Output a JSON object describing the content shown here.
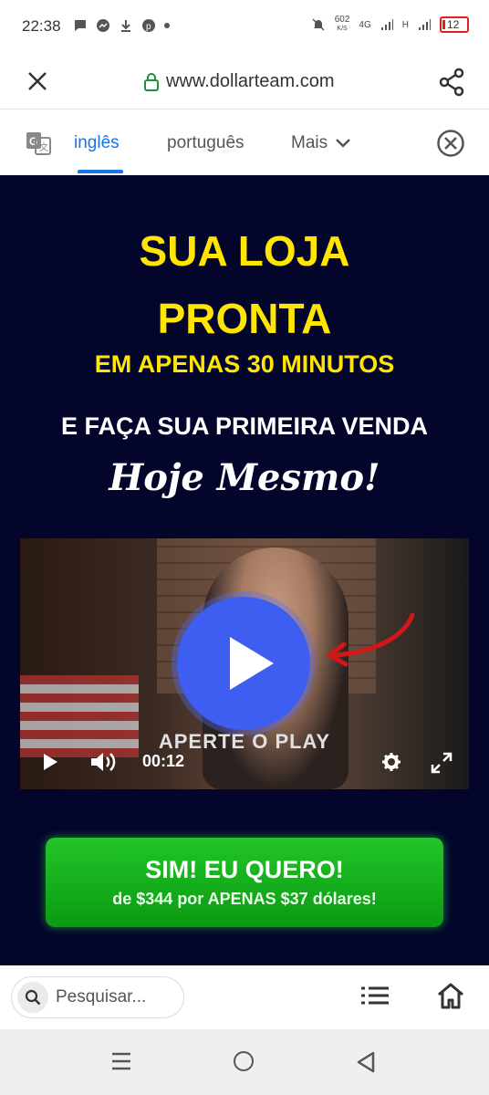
{
  "status_bar": {
    "time": "22:38",
    "speed": "602",
    "speed_unit": "K/S",
    "network": "4G",
    "network2": "H",
    "battery": "12"
  },
  "browser": {
    "url": "www.dollarteam.com"
  },
  "translate_bar": {
    "tabs": [
      "inglês",
      "português"
    ],
    "more_label": "Mais"
  },
  "hero": {
    "line1": "SUA LOJA",
    "line2": "PRONTA",
    "line3": "EM APENAS 30 MINUTOS",
    "line4": "E FAÇA SUA PRIMEIRA VENDA",
    "line5": "Hoje Mesmo!"
  },
  "video": {
    "overlay_text": "APERTE O PLAY",
    "time": "00:12"
  },
  "cta": {
    "title": "SIM! EU QUERO!",
    "subtitle": "de $344 por APENAS $37 dólares!"
  },
  "bottom_bar": {
    "search_placeholder": "Pesquisar..."
  },
  "colors": {
    "hero_bg": "#03052b",
    "headline_yellow": "#ffe600",
    "cta_green": "#0a9a10",
    "play_blue": "#3d5ef0",
    "active_tab": "#1a73e8"
  }
}
